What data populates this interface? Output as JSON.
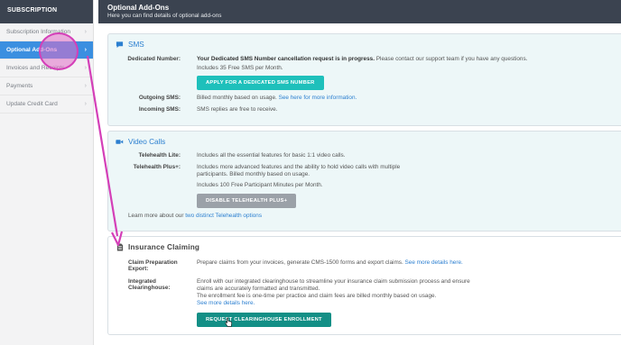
{
  "sidebar": {
    "heading": "SUBSCRIPTION",
    "items": [
      {
        "label": "Subscription Information",
        "active": false
      },
      {
        "label": "Optional Add-Ons",
        "active": true
      },
      {
        "label": "Invoices and Receipts",
        "active": false
      },
      {
        "label": "Payments",
        "active": false
      },
      {
        "label": "Update Credit Card",
        "active": false
      }
    ]
  },
  "header": {
    "title": "Optional Add-Ons",
    "subtitle": "Here you can find details of optional add-ons"
  },
  "sms": {
    "title": "SMS",
    "dedicated_label": "Dedicated Number:",
    "dedicated_bold": "Your Dedicated SMS Number cancellation request is in progress.",
    "dedicated_rest": " Please contact our support team if you have any questions.",
    "includes": "Includes 35 Free SMS per Month.",
    "apply_button": "APPLY FOR A DEDICATED SMS NUMBER",
    "outgoing_label": "Outgoing SMS:",
    "outgoing_text": "Billed monthly based on usage.",
    "outgoing_link": "See here for more information.",
    "incoming_label": "Incoming SMS:",
    "incoming_text": "SMS replies are free to receive."
  },
  "video": {
    "title": "Video Calls",
    "lite_label": "Telehealth Lite:",
    "lite_text": "Includes all the essential features for basic 1:1 video calls.",
    "plus_label": "Telehealth Plus+:",
    "plus_text1": "Includes more advanced features and the ability to hold video calls with multiple",
    "plus_text2": "participants. Billed monthly based on usage.",
    "plus_includes": "Includes 100 Free Participant Minutes per Month.",
    "disable_button": "DISABLE TELEHEALTH PLUS+",
    "learn_prefix": "Learn more about our ",
    "learn_link": "two distinct Telehealth options"
  },
  "insurance": {
    "title": "Insurance Claiming",
    "prep_label1": "Claim Preparation",
    "prep_label2": "Export:",
    "prep_text": "Prepare claims from your invoices, generate CMS-1500 forms and export claims.",
    "prep_link": "See more details here.",
    "integ_label1": "Integrated",
    "integ_label2": "Clearinghouse:",
    "integ_text1": "Enroll with our integrated clearinghouse to streamline your insurance claim submission process and ensure",
    "integ_text2": "claims are accurately formatted and transmitted.",
    "integ_text3": "The enrollment fee is one-time per practice and claim fees are billed monthly based on usage.",
    "integ_link": "See more details here.",
    "enroll_button": "REQUEST CLEARINGHOUSE ENROLLMENT"
  },
  "colors": {
    "header_bg": "#3b4350",
    "active_item": "#3b8fe0",
    "link": "#2b7fd0",
    "teal_button": "#1ec0bb",
    "grey_button": "#9ba1a8",
    "green_button": "#138f86",
    "annotation": "#d43fb8"
  },
  "icons": {
    "sms": "chat-bubble-icon",
    "video": "video-camera-icon",
    "insurance": "document-icon",
    "chevron": "chevron-right-icon"
  }
}
